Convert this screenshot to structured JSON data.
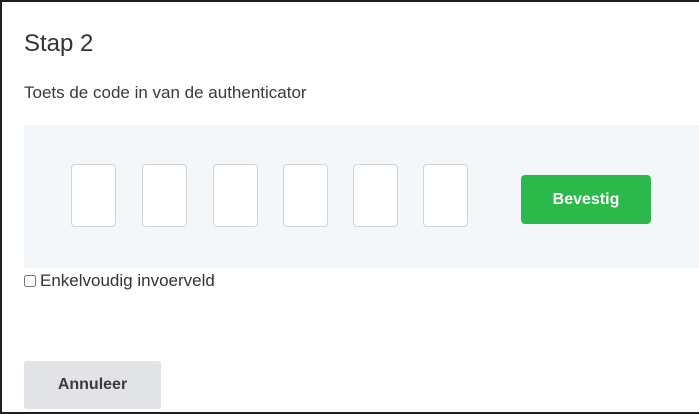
{
  "step": {
    "title": "Stap 2",
    "instruction": "Toets de code in van de authenticator"
  },
  "code_entry": {
    "digits": [
      "",
      "",
      "",
      "",
      "",
      ""
    ],
    "confirm_label": "Bevestig",
    "confirm_color": "#2cb84b"
  },
  "single_field": {
    "label": "Enkelvoudig invoerveld",
    "checked": false
  },
  "actions": {
    "cancel_label": "Annuleer"
  }
}
